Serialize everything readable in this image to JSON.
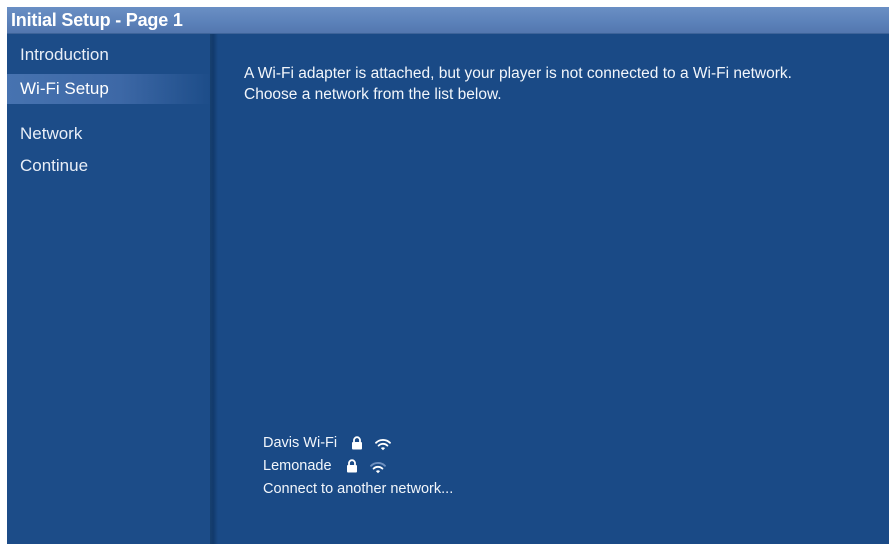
{
  "window": {
    "title": "Initial Setup - Page 1"
  },
  "sidebar": {
    "items": [
      {
        "label": "Introduction",
        "selected": false
      },
      {
        "label": "Wi-Fi Setup",
        "selected": true
      },
      {
        "label": "Network",
        "selected": false
      },
      {
        "label": "Continue",
        "selected": false
      }
    ]
  },
  "main": {
    "message": "A Wi-Fi adapter is attached, but your player is not connected to a Wi-Fi network. Choose a network from the list below.",
    "networks": [
      {
        "name": "Davis Wi-Fi",
        "icons": [
          "lock-icon",
          "wifi-signal-icon"
        ],
        "secured": true
      },
      {
        "name": "Lemonade",
        "icons": [
          "lock-icon",
          "wifi-signal-icon"
        ],
        "secured": true
      }
    ],
    "other_network_label": "Connect to another network..."
  },
  "colors": {
    "background": "#1a4a86",
    "titlebar": "#5b81b9",
    "selection": "#4773b0",
    "text": "#ffffff"
  }
}
